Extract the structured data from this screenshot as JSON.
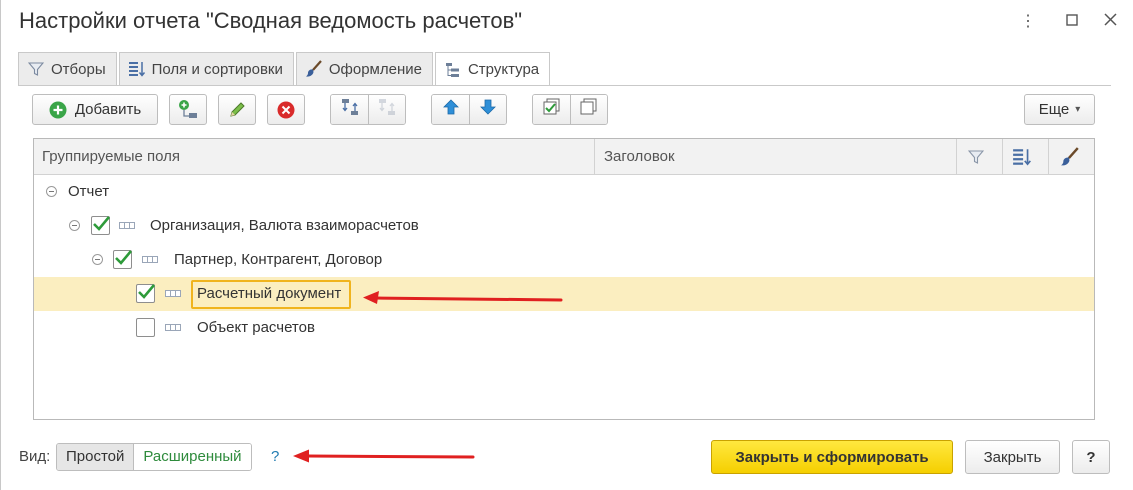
{
  "window": {
    "title": "Настройки отчета \"Сводная ведомость расчетов\"",
    "controls": [
      "more-icon",
      "maximize-icon",
      "close-icon"
    ]
  },
  "tabs": [
    {
      "label": "Отборы",
      "icon": "filter-icon"
    },
    {
      "label": "Поля и сортировки",
      "icon": "fields-sort-icon"
    },
    {
      "label": "Оформление",
      "icon": "brush-icon"
    },
    {
      "label": "Структура",
      "icon": "structure-icon",
      "active": true
    }
  ],
  "toolbar": {
    "add_label": "Добавить",
    "more_label": "Еще",
    "more_caret": "▾"
  },
  "table": {
    "columns": [
      "Группируемые поля",
      "Заголовок"
    ],
    "column_icons": [
      "filter-icon",
      "fields-sort-icon",
      "brush-icon"
    ],
    "rows": [
      {
        "label": "Отчет",
        "level": 0,
        "expanded": true,
        "checkbox": false
      },
      {
        "label": "Организация, Валюта взаиморасчетов",
        "level": 1,
        "expanded": true,
        "checked": true
      },
      {
        "label": "Партнер, Контрагент, Договор",
        "level": 2,
        "expanded": true,
        "checked": true
      },
      {
        "label": "Расчетный документ",
        "level": 3,
        "checked": true,
        "selected": true
      },
      {
        "label": "Объект расчетов",
        "level": 3,
        "checked": false
      }
    ]
  },
  "footer": {
    "view_label": "Вид:",
    "view_simple": "Простой",
    "view_extended": "Расширенный",
    "help_link": "?",
    "primary_button": "Закрыть и сформировать",
    "close_button": "Закрыть",
    "help_button": "?"
  },
  "colors": {
    "accent_yellow": "#f5cf00",
    "selected_row": "#fbeec0",
    "annotation_arrow": "#e02020",
    "check_green": "#2e9b3a"
  }
}
